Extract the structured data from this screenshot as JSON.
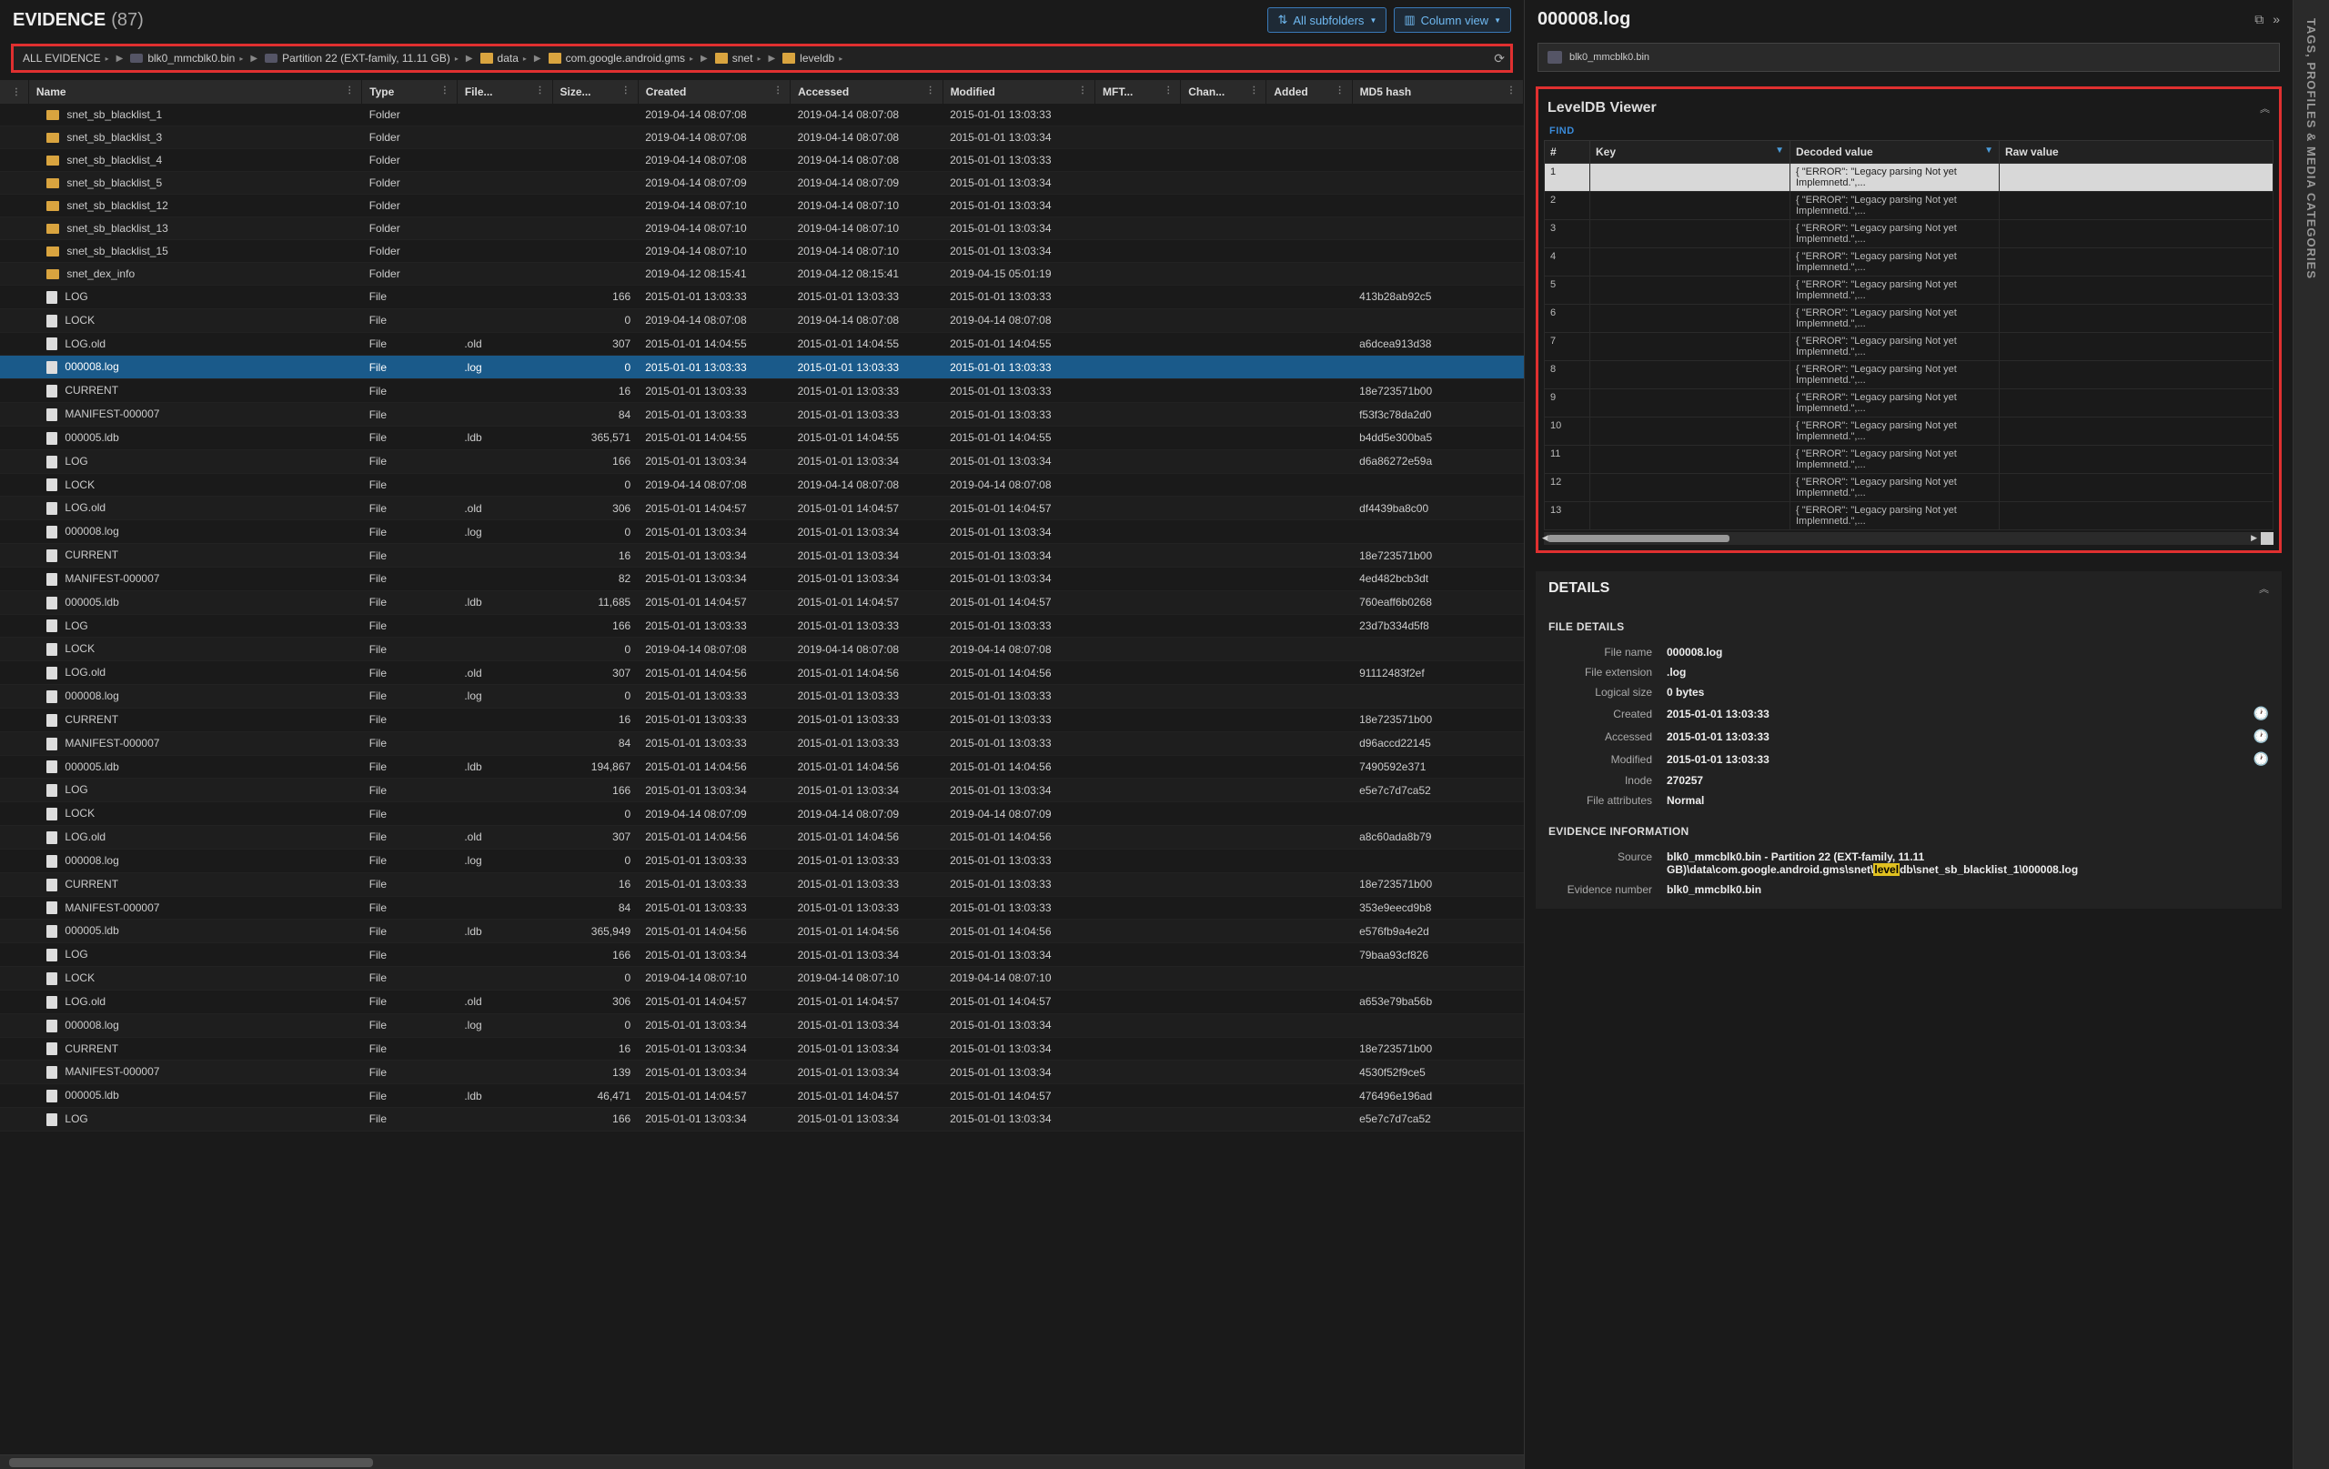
{
  "header": {
    "title": "EVIDENCE",
    "count": "(87)",
    "btn_subfolders": "All subfolders",
    "btn_columnview": "Column view"
  },
  "breadcrumb": [
    {
      "label": "ALL EVIDENCE",
      "icon": "root"
    },
    {
      "label": "blk0_mmcblk0.bin",
      "icon": "drive"
    },
    {
      "label": "Partition 22 (EXT-family, 11.11 GB)",
      "icon": "drive"
    },
    {
      "label": "data",
      "icon": "folder"
    },
    {
      "label": "com.google.android.gms",
      "icon": "folder"
    },
    {
      "label": "snet",
      "icon": "folder"
    },
    {
      "label": "leveldb",
      "icon": "folder"
    }
  ],
  "columns": [
    "",
    "Name",
    "Type",
    "File...",
    "Size...",
    "Created",
    "Accessed",
    "Modified",
    "MFT...",
    "Chan...",
    "Added",
    "MD5 hash"
  ],
  "rows": [
    {
      "icon": "folder",
      "name": "snet_sb_blacklist_1",
      "type": "Folder",
      "ext": "",
      "size": "",
      "created": "2019-04-14 08:07:08",
      "accessed": "2019-04-14 08:07:08",
      "modified": "2015-01-01 13:03:33",
      "md5": ""
    },
    {
      "icon": "folder",
      "name": "snet_sb_blacklist_3",
      "type": "Folder",
      "ext": "",
      "size": "",
      "created": "2019-04-14 08:07:08",
      "accessed": "2019-04-14 08:07:08",
      "modified": "2015-01-01 13:03:34",
      "md5": ""
    },
    {
      "icon": "folder",
      "name": "snet_sb_blacklist_4",
      "type": "Folder",
      "ext": "",
      "size": "",
      "created": "2019-04-14 08:07:08",
      "accessed": "2019-04-14 08:07:08",
      "modified": "2015-01-01 13:03:33",
      "md5": ""
    },
    {
      "icon": "folder",
      "name": "snet_sb_blacklist_5",
      "type": "Folder",
      "ext": "",
      "size": "",
      "created": "2019-04-14 08:07:09",
      "accessed": "2019-04-14 08:07:09",
      "modified": "2015-01-01 13:03:34",
      "md5": ""
    },
    {
      "icon": "folder",
      "name": "snet_sb_blacklist_12",
      "type": "Folder",
      "ext": "",
      "size": "",
      "created": "2019-04-14 08:07:10",
      "accessed": "2019-04-14 08:07:10",
      "modified": "2015-01-01 13:03:34",
      "md5": ""
    },
    {
      "icon": "folder",
      "name": "snet_sb_blacklist_13",
      "type": "Folder",
      "ext": "",
      "size": "",
      "created": "2019-04-14 08:07:10",
      "accessed": "2019-04-14 08:07:10",
      "modified": "2015-01-01 13:03:34",
      "md5": ""
    },
    {
      "icon": "folder",
      "name": "snet_sb_blacklist_15",
      "type": "Folder",
      "ext": "",
      "size": "",
      "created": "2019-04-14 08:07:10",
      "accessed": "2019-04-14 08:07:10",
      "modified": "2015-01-01 13:03:34",
      "md5": ""
    },
    {
      "icon": "folder",
      "name": "snet_dex_info",
      "type": "Folder",
      "ext": "",
      "size": "",
      "created": "2019-04-12 08:15:41",
      "accessed": "2019-04-12 08:15:41",
      "modified": "2019-04-15 05:01:19",
      "md5": ""
    },
    {
      "icon": "file",
      "name": "LOG",
      "type": "File",
      "ext": "",
      "size": "166",
      "created": "2015-01-01 13:03:33",
      "accessed": "2015-01-01 13:03:33",
      "modified": "2015-01-01 13:03:33",
      "md5": "413b28ab92c5"
    },
    {
      "icon": "file",
      "name": "LOCK",
      "type": "File",
      "ext": "",
      "size": "0",
      "created": "2019-04-14 08:07:08",
      "accessed": "2019-04-14 08:07:08",
      "modified": "2019-04-14 08:07:08",
      "md5": ""
    },
    {
      "icon": "file",
      "name": "LOG.old",
      "type": "File",
      "ext": ".old",
      "size": "307",
      "created": "2015-01-01 14:04:55",
      "accessed": "2015-01-01 14:04:55",
      "modified": "2015-01-01 14:04:55",
      "md5": "a6dcea913d38"
    },
    {
      "icon": "file",
      "name": "000008.log",
      "type": "File",
      "ext": ".log",
      "size": "0",
      "created": "2015-01-01 13:03:33",
      "accessed": "2015-01-01 13:03:33",
      "modified": "2015-01-01 13:03:33",
      "md5": "",
      "selected": true
    },
    {
      "icon": "file",
      "name": "CURRENT",
      "type": "File",
      "ext": "",
      "size": "16",
      "created": "2015-01-01 13:03:33",
      "accessed": "2015-01-01 13:03:33",
      "modified": "2015-01-01 13:03:33",
      "md5": "18e723571b00"
    },
    {
      "icon": "file",
      "name": "MANIFEST-000007",
      "type": "File",
      "ext": "",
      "size": "84",
      "created": "2015-01-01 13:03:33",
      "accessed": "2015-01-01 13:03:33",
      "modified": "2015-01-01 13:03:33",
      "md5": "f53f3c78da2d0"
    },
    {
      "icon": "file",
      "name": "000005.ldb",
      "type": "File",
      "ext": ".ldb",
      "size": "365,571",
      "created": "2015-01-01 14:04:55",
      "accessed": "2015-01-01 14:04:55",
      "modified": "2015-01-01 14:04:55",
      "md5": "b4dd5e300ba5"
    },
    {
      "icon": "file",
      "name": "LOG",
      "type": "File",
      "ext": "",
      "size": "166",
      "created": "2015-01-01 13:03:34",
      "accessed": "2015-01-01 13:03:34",
      "modified": "2015-01-01 13:03:34",
      "md5": "d6a86272e59a"
    },
    {
      "icon": "file",
      "name": "LOCK",
      "type": "File",
      "ext": "",
      "size": "0",
      "created": "2019-04-14 08:07:08",
      "accessed": "2019-04-14 08:07:08",
      "modified": "2019-04-14 08:07:08",
      "md5": ""
    },
    {
      "icon": "file",
      "name": "LOG.old",
      "type": "File",
      "ext": ".old",
      "size": "306",
      "created": "2015-01-01 14:04:57",
      "accessed": "2015-01-01 14:04:57",
      "modified": "2015-01-01 14:04:57",
      "md5": "df4439ba8c00"
    },
    {
      "icon": "file",
      "name": "000008.log",
      "type": "File",
      "ext": ".log",
      "size": "0",
      "created": "2015-01-01 13:03:34",
      "accessed": "2015-01-01 13:03:34",
      "modified": "2015-01-01 13:03:34",
      "md5": ""
    },
    {
      "icon": "file",
      "name": "CURRENT",
      "type": "File",
      "ext": "",
      "size": "16",
      "created": "2015-01-01 13:03:34",
      "accessed": "2015-01-01 13:03:34",
      "modified": "2015-01-01 13:03:34",
      "md5": "18e723571b00"
    },
    {
      "icon": "file",
      "name": "MANIFEST-000007",
      "type": "File",
      "ext": "",
      "size": "82",
      "created": "2015-01-01 13:03:34",
      "accessed": "2015-01-01 13:03:34",
      "modified": "2015-01-01 13:03:34",
      "md5": "4ed482bcb3dt"
    },
    {
      "icon": "file",
      "name": "000005.ldb",
      "type": "File",
      "ext": ".ldb",
      "size": "11,685",
      "created": "2015-01-01 14:04:57",
      "accessed": "2015-01-01 14:04:57",
      "modified": "2015-01-01 14:04:57",
      "md5": "760eaff6b0268"
    },
    {
      "icon": "file",
      "name": "LOG",
      "type": "File",
      "ext": "",
      "size": "166",
      "created": "2015-01-01 13:03:33",
      "accessed": "2015-01-01 13:03:33",
      "modified": "2015-01-01 13:03:33",
      "md5": "23d7b334d5f8"
    },
    {
      "icon": "file",
      "name": "LOCK",
      "type": "File",
      "ext": "",
      "size": "0",
      "created": "2019-04-14 08:07:08",
      "accessed": "2019-04-14 08:07:08",
      "modified": "2019-04-14 08:07:08",
      "md5": ""
    },
    {
      "icon": "file",
      "name": "LOG.old",
      "type": "File",
      "ext": ".old",
      "size": "307",
      "created": "2015-01-01 14:04:56",
      "accessed": "2015-01-01 14:04:56",
      "modified": "2015-01-01 14:04:56",
      "md5": "91112483f2ef"
    },
    {
      "icon": "file",
      "name": "000008.log",
      "type": "File",
      "ext": ".log",
      "size": "0",
      "created": "2015-01-01 13:03:33",
      "accessed": "2015-01-01 13:03:33",
      "modified": "2015-01-01 13:03:33",
      "md5": ""
    },
    {
      "icon": "file",
      "name": "CURRENT",
      "type": "File",
      "ext": "",
      "size": "16",
      "created": "2015-01-01 13:03:33",
      "accessed": "2015-01-01 13:03:33",
      "modified": "2015-01-01 13:03:33",
      "md5": "18e723571b00"
    },
    {
      "icon": "file",
      "name": "MANIFEST-000007",
      "type": "File",
      "ext": "",
      "size": "84",
      "created": "2015-01-01 13:03:33",
      "accessed": "2015-01-01 13:03:33",
      "modified": "2015-01-01 13:03:33",
      "md5": "d96accd22145"
    },
    {
      "icon": "file",
      "name": "000005.ldb",
      "type": "File",
      "ext": ".ldb",
      "size": "194,867",
      "created": "2015-01-01 14:04:56",
      "accessed": "2015-01-01 14:04:56",
      "modified": "2015-01-01 14:04:56",
      "md5": "7490592e371"
    },
    {
      "icon": "file",
      "name": "LOG",
      "type": "File",
      "ext": "",
      "size": "166",
      "created": "2015-01-01 13:03:34",
      "accessed": "2015-01-01 13:03:34",
      "modified": "2015-01-01 13:03:34",
      "md5": "e5e7c7d7ca52"
    },
    {
      "icon": "file",
      "name": "LOCK",
      "type": "File",
      "ext": "",
      "size": "0",
      "created": "2019-04-14 08:07:09",
      "accessed": "2019-04-14 08:07:09",
      "modified": "2019-04-14 08:07:09",
      "md5": ""
    },
    {
      "icon": "file",
      "name": "LOG.old",
      "type": "File",
      "ext": ".old",
      "size": "307",
      "created": "2015-01-01 14:04:56",
      "accessed": "2015-01-01 14:04:56",
      "modified": "2015-01-01 14:04:56",
      "md5": "a8c60ada8b79"
    },
    {
      "icon": "file",
      "name": "000008.log",
      "type": "File",
      "ext": ".log",
      "size": "0",
      "created": "2015-01-01 13:03:33",
      "accessed": "2015-01-01 13:03:33",
      "modified": "2015-01-01 13:03:33",
      "md5": ""
    },
    {
      "icon": "file",
      "name": "CURRENT",
      "type": "File",
      "ext": "",
      "size": "16",
      "created": "2015-01-01 13:03:33",
      "accessed": "2015-01-01 13:03:33",
      "modified": "2015-01-01 13:03:33",
      "md5": "18e723571b00"
    },
    {
      "icon": "file",
      "name": "MANIFEST-000007",
      "type": "File",
      "ext": "",
      "size": "84",
      "created": "2015-01-01 13:03:33",
      "accessed": "2015-01-01 13:03:33",
      "modified": "2015-01-01 13:03:33",
      "md5": "353e9eecd9b8"
    },
    {
      "icon": "file",
      "name": "000005.ldb",
      "type": "File",
      "ext": ".ldb",
      "size": "365,949",
      "created": "2015-01-01 14:04:56",
      "accessed": "2015-01-01 14:04:56",
      "modified": "2015-01-01 14:04:56",
      "md5": "e576fb9a4e2d"
    },
    {
      "icon": "file",
      "name": "LOG",
      "type": "File",
      "ext": "",
      "size": "166",
      "created": "2015-01-01 13:03:34",
      "accessed": "2015-01-01 13:03:34",
      "modified": "2015-01-01 13:03:34",
      "md5": "79baa93cf826"
    },
    {
      "icon": "file",
      "name": "LOCK",
      "type": "File",
      "ext": "",
      "size": "0",
      "created": "2019-04-14 08:07:10",
      "accessed": "2019-04-14 08:07:10",
      "modified": "2019-04-14 08:07:10",
      "md5": ""
    },
    {
      "icon": "file",
      "name": "LOG.old",
      "type": "File",
      "ext": ".old",
      "size": "306",
      "created": "2015-01-01 14:04:57",
      "accessed": "2015-01-01 14:04:57",
      "modified": "2015-01-01 14:04:57",
      "md5": "a653e79ba56b"
    },
    {
      "icon": "file",
      "name": "000008.log",
      "type": "File",
      "ext": ".log",
      "size": "0",
      "created": "2015-01-01 13:03:34",
      "accessed": "2015-01-01 13:03:34",
      "modified": "2015-01-01 13:03:34",
      "md5": ""
    },
    {
      "icon": "file",
      "name": "CURRENT",
      "type": "File",
      "ext": "",
      "size": "16",
      "created": "2015-01-01 13:03:34",
      "accessed": "2015-01-01 13:03:34",
      "modified": "2015-01-01 13:03:34",
      "md5": "18e723571b00"
    },
    {
      "icon": "file",
      "name": "MANIFEST-000007",
      "type": "File",
      "ext": "",
      "size": "139",
      "created": "2015-01-01 13:03:34",
      "accessed": "2015-01-01 13:03:34",
      "modified": "2015-01-01 13:03:34",
      "md5": "4530f52f9ce5"
    },
    {
      "icon": "file",
      "name": "000005.ldb",
      "type": "File",
      "ext": ".ldb",
      "size": "46,471",
      "created": "2015-01-01 14:04:57",
      "accessed": "2015-01-01 14:04:57",
      "modified": "2015-01-01 14:04:57",
      "md5": "476496e196ad"
    },
    {
      "icon": "file",
      "name": "LOG",
      "type": "File",
      "ext": "",
      "size": "166",
      "created": "2015-01-01 13:03:34",
      "accessed": "2015-01-01 13:03:34",
      "modified": "2015-01-01 13:03:34",
      "md5": "e5e7c7d7ca52"
    }
  ],
  "right": {
    "title": "000008.log",
    "chip": "blk0_mmcblk0.bin",
    "viewer_title": "LevelDB Viewer",
    "find": "FIND",
    "ldb_cols": [
      "#",
      "Key",
      "Decoded value",
      "Raw value"
    ],
    "ldb_rows": [
      {
        "n": "1",
        "decoded": "{  \"ERROR\": \"Legacy parsing Not yet Implemnetd.\",..."
      },
      {
        "n": "2",
        "decoded": "{  \"ERROR\": \"Legacy parsing Not yet Implemnetd.\",..."
      },
      {
        "n": "3",
        "decoded": "{  \"ERROR\": \"Legacy parsing Not yet Implemnetd.\",..."
      },
      {
        "n": "4",
        "decoded": "{  \"ERROR\": \"Legacy parsing Not yet Implemnetd.\",..."
      },
      {
        "n": "5",
        "decoded": "{  \"ERROR\": \"Legacy parsing Not yet Implemnetd.\",..."
      },
      {
        "n": "6",
        "decoded": "{  \"ERROR\": \"Legacy parsing Not yet Implemnetd.\",..."
      },
      {
        "n": "7",
        "decoded": "{  \"ERROR\": \"Legacy parsing Not yet Implemnetd.\",..."
      },
      {
        "n": "8",
        "decoded": "{  \"ERROR\": \"Legacy parsing Not yet Implemnetd.\",..."
      },
      {
        "n": "9",
        "decoded": "{  \"ERROR\": \"Legacy parsing Not yet Implemnetd.\",..."
      },
      {
        "n": "10",
        "decoded": "{  \"ERROR\": \"Legacy parsing Not yet Implemnetd.\",..."
      },
      {
        "n": "11",
        "decoded": "{  \"ERROR\": \"Legacy parsing Not yet Implemnetd.\",..."
      },
      {
        "n": "12",
        "decoded": "{  \"ERROR\": \"Legacy parsing Not yet Implemnetd.\",..."
      },
      {
        "n": "13",
        "decoded": "{  \"ERROR\": \"Legacy parsing Not yet Implemnetd.\",..."
      }
    ],
    "details_title": "DETAILS",
    "file_details_label": "FILE DETAILS",
    "evidence_info_label": "EVIDENCE INFORMATION",
    "details": [
      {
        "label": "File name",
        "val": "000008.log"
      },
      {
        "label": "File extension",
        "val": ".log"
      },
      {
        "label": "Logical size",
        "val": "0 bytes"
      },
      {
        "label": "Created",
        "val": "2015-01-01 13:03:33",
        "clock": true
      },
      {
        "label": "Accessed",
        "val": "2015-01-01 13:03:33",
        "clock": true
      },
      {
        "label": "Modified",
        "val": "2015-01-01 13:03:33",
        "clock": true
      },
      {
        "label": "Inode",
        "val": "270257"
      },
      {
        "label": "File attributes",
        "val": "Normal"
      }
    ],
    "evidence": [
      {
        "label": "Source",
        "val": "blk0_mmcblk0.bin - Partition 22 (EXT-family, 11.11 GB)\\data\\com.google.android.gms\\snet\\",
        "hl": "level",
        "tail": "db\\snet_sb_blacklist_1\\000008.log"
      },
      {
        "label": "Evidence number",
        "val": "blk0_mmcblk0.bin"
      }
    ]
  },
  "side_rail": "TAGS, PROFILES & MEDIA CATEGORIES"
}
